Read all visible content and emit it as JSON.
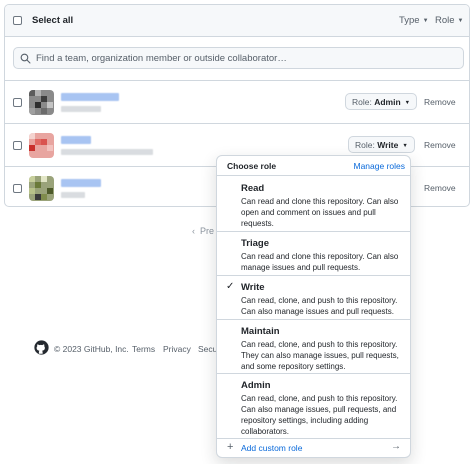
{
  "header": {
    "select_all": "Select all",
    "filter_type": "Type",
    "filter_role": "Role"
  },
  "search": {
    "placeholder": "Find a team, organization member or outside collaborator…"
  },
  "rows": [
    {
      "role_prefix": "Role:",
      "role_value": "Admin",
      "remove": "Remove"
    },
    {
      "role_prefix": "Role:",
      "role_value": "Write",
      "remove": "Remove"
    },
    {
      "remove": "Remove"
    }
  ],
  "pagination": {
    "prev": "Pre"
  },
  "footer": {
    "copyright": "© 2023 GitHub, Inc.",
    "terms": "Terms",
    "privacy": "Privacy",
    "security": "Secu"
  },
  "role_menu": {
    "title": "Choose role",
    "manage": "Manage roles",
    "selected": "Write",
    "options": [
      {
        "title": "Read",
        "desc": "Can read and clone this repository. Can also open and comment on issues and pull requests."
      },
      {
        "title": "Triage",
        "desc": "Can read and clone this repository. Can also manage issues and pull requests."
      },
      {
        "title": "Write",
        "desc": "Can read, clone, and push to this repository. Can also manage issues and pull requests."
      },
      {
        "title": "Maintain",
        "desc": "Can read, clone, and push to this repository. They can also manage issues, pull requests, and some repository settings."
      },
      {
        "title": "Admin",
        "desc": "Can read, clone, and push to this repository. Can also manage issues, pull requests, and repository settings, including adding collaborators."
      }
    ],
    "add_custom": "Add custom role"
  },
  "colors": {
    "accent": "#0969da",
    "border": "#d0d7de",
    "muted": "#57606a"
  },
  "icons": [
    "search-icon",
    "caret-down-icon",
    "check-icon",
    "plus-icon",
    "arrow-right-icon",
    "github-logo-icon",
    "chevron-left-icon"
  ]
}
